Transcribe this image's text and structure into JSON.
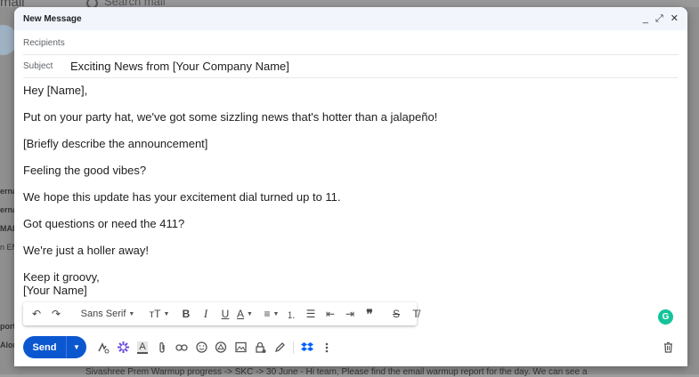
{
  "background": {
    "app_logo": "mail",
    "search_placeholder": "Search mail",
    "side_labels": [
      "erna",
      "erna",
      "MAIL",
      "n EM",
      "port",
      "Alon"
    ],
    "email_row": "Sivashree Prem          Warmup progress -> SKC -> 30 June - Hi team, Please find the email warmup report for the day. We can see a"
  },
  "compose": {
    "title": "New Message",
    "controls": {
      "minimize": "_",
      "expand": "⤢",
      "close": "✕"
    },
    "recipients_placeholder": "Recipients",
    "subject_label": "Subject",
    "subject_value": "Exciting News from [Your Company Name]",
    "body": [
      "Hey [Name],",
      "Put on your party hat, we've got some sizzling news that's hotter than a jalapeño!",
      "[Briefly describe the announcement]",
      "Feeling the good vibes?",
      "We hope this update has your excitement dial turned up to 11.",
      "Got questions or need the 411?",
      "We're just a holler away!"
    ],
    "signature": [
      "Keep it groovy,",
      "[Your Name]"
    ],
    "grammarly_label": "G"
  },
  "format_toolbar": {
    "undo": "↶",
    "redo": "↷",
    "font": "Sans Serif",
    "size": "тT",
    "bold": "B",
    "italic": "I",
    "underline": "U",
    "text_color": "A",
    "align": "≡",
    "numbered_list": "⒈",
    "bulleted_list": "☰",
    "indent_less": "⇤",
    "indent_more": "⇥",
    "quote": "❞",
    "strikethrough": "S",
    "clear_formatting": "T̸"
  },
  "bottom_bar": {
    "send_label": "Send",
    "more_send": "▼",
    "colors": {
      "send": "#0b57d0",
      "grammarly": "#15c39a",
      "dropbox": "#0061fe",
      "sparkle": "#6b4cde"
    }
  }
}
